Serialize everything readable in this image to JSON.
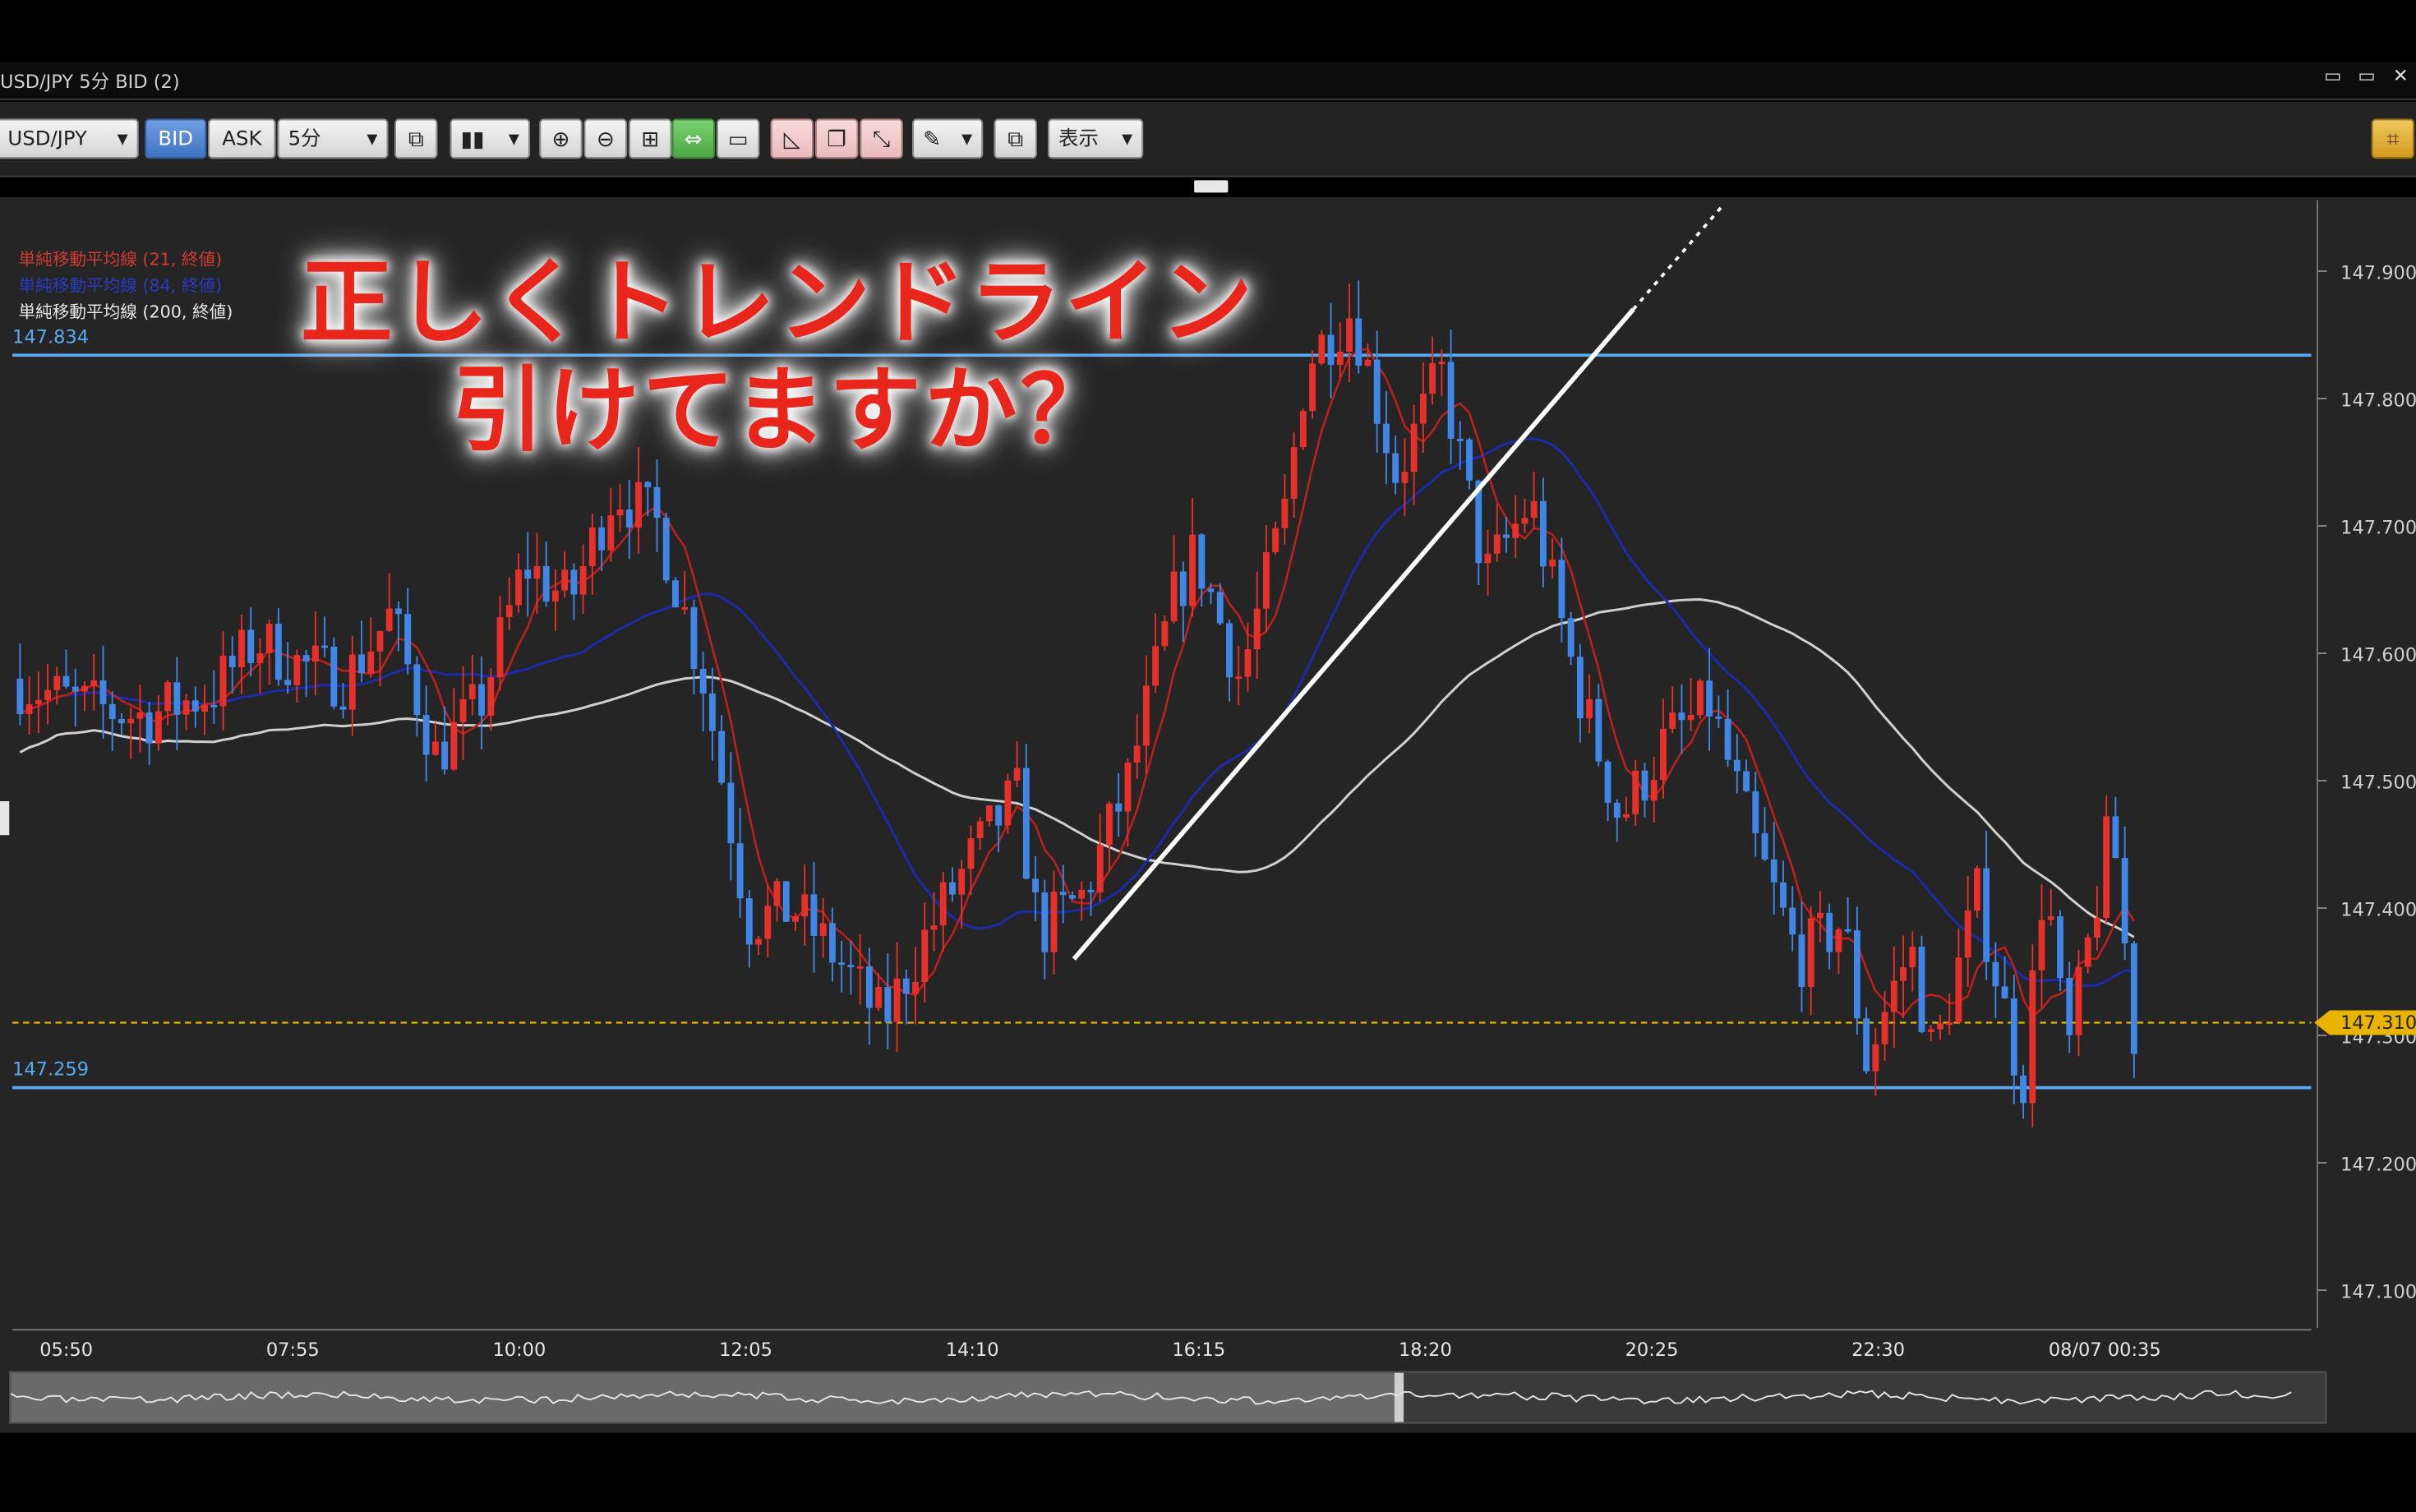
{
  "window": {
    "title": "USD/JPY 5分 BID (2)",
    "buttons": [
      "minimize",
      "maximize",
      "close"
    ]
  },
  "toolbar": {
    "symbol": "USD/JPY",
    "bid_label": "BID",
    "ask_label": "ASK",
    "timeframe": "5分",
    "display_label": "表示"
  },
  "overlay_text": {
    "line1": "正しくトレンドライン",
    "line2": "引けてますか？"
  },
  "legend": {
    "ma21": "単純移動平均線 (21, 終値)",
    "ma84": "単純移動平均線 (84, 終値)",
    "ma200": "単純移動平均線 (200, 終値)"
  },
  "colors": {
    "background": "#252525",
    "candle_up": "#e8302a",
    "candle_down": "#3f86e6",
    "ma21": "#b8201c",
    "ma84": "#1c2aa8",
    "ma200": "#d0d0d0",
    "hline": "#5aa8f0",
    "current_price": "#e8b400",
    "trendline": "#ffffff"
  },
  "chart_data": {
    "type": "candlestick",
    "symbol": "USD/JPY",
    "timeframe": "5分",
    "y_ticks": [
      "147.900",
      "147.800",
      "147.700",
      "147.600",
      "147.500",
      "147.400",
      "147.300",
      "147.200",
      "147.100"
    ],
    "ylim": [
      147.06,
      147.96
    ],
    "x_ticks": [
      "05:50",
      "07:55",
      "10:00",
      "12:05",
      "14:10",
      "16:15",
      "18:20",
      "20:25",
      "22:30",
      "08/07 00:35"
    ],
    "horizontal_lines": [
      {
        "label": "147.834",
        "value": 147.834
      },
      {
        "label": "147.259",
        "value": 147.259
      }
    ],
    "current_price": {
      "label": "147.310",
      "value": 147.31
    },
    "trendline": {
      "x_start": "15:00",
      "y_start": 147.36,
      "x_end": "18:45",
      "y_end": 147.87,
      "dotted_to": 147.95
    },
    "close_path": [
      [
        0,
        147.58
      ],
      [
        0.03,
        147.56
      ],
      [
        0.06,
        147.55
      ],
      [
        0.09,
        147.57
      ],
      [
        0.11,
        147.61
      ],
      [
        0.13,
        147.59
      ],
      [
        0.15,
        147.58
      ],
      [
        0.17,
        147.63
      ],
      [
        0.19,
        147.52
      ],
      [
        0.21,
        147.56
      ],
      [
        0.23,
        147.67
      ],
      [
        0.25,
        147.64
      ],
      [
        0.27,
        147.73
      ],
      [
        0.29,
        147.7
      ],
      [
        0.31,
        147.58
      ],
      [
        0.33,
        147.39
      ],
      [
        0.35,
        147.4
      ],
      [
        0.37,
        147.36
      ],
      [
        0.39,
        147.31
      ],
      [
        0.41,
        147.38
      ],
      [
        0.43,
        147.44
      ],
      [
        0.45,
        147.49
      ],
      [
        0.46,
        147.38
      ],
      [
        0.48,
        147.41
      ],
      [
        0.5,
        147.5
      ],
      [
        0.52,
        147.64
      ],
      [
        0.53,
        147.68
      ],
      [
        0.55,
        147.58
      ],
      [
        0.57,
        147.71
      ],
      [
        0.58,
        147.83
      ],
      [
        0.6,
        147.87
      ],
      [
        0.62,
        147.74
      ],
      [
        0.64,
        147.82
      ],
      [
        0.66,
        147.66
      ],
      [
        0.68,
        147.72
      ],
      [
        0.7,
        147.58
      ],
      [
        0.72,
        147.47
      ],
      [
        0.74,
        147.53
      ],
      [
        0.76,
        147.56
      ],
      [
        0.78,
        147.45
      ],
      [
        0.8,
        147.36
      ],
      [
        0.82,
        147.39
      ],
      [
        0.83,
        147.28
      ],
      [
        0.85,
        147.37
      ],
      [
        0.86,
        147.28
      ],
      [
        0.88,
        147.41
      ],
      [
        0.9,
        147.26
      ],
      [
        0.91,
        147.43
      ],
      [
        0.92,
        147.28
      ],
      [
        0.94,
        147.47
      ],
      [
        0.95,
        147.3
      ]
    ]
  }
}
